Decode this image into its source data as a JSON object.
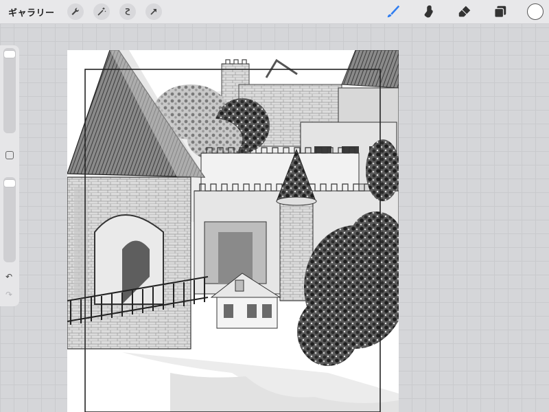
{
  "topbar": {
    "gallery_label": "ギャラリー",
    "left_tools": [
      "wrench-icon",
      "magic-wand-icon",
      "selection-icon",
      "transform-arrow-icon"
    ],
    "right_tools": [
      "brush-icon",
      "smudge-icon",
      "eraser-icon",
      "layers-icon"
    ],
    "active_tool": "brush-icon",
    "accent_color": "#2f7df0",
    "current_color": "#ffffff"
  },
  "sidebar": {
    "brush_size": 0.03,
    "opacity": 0.03
  },
  "canvas": {
    "content": "castle-illustration"
  }
}
